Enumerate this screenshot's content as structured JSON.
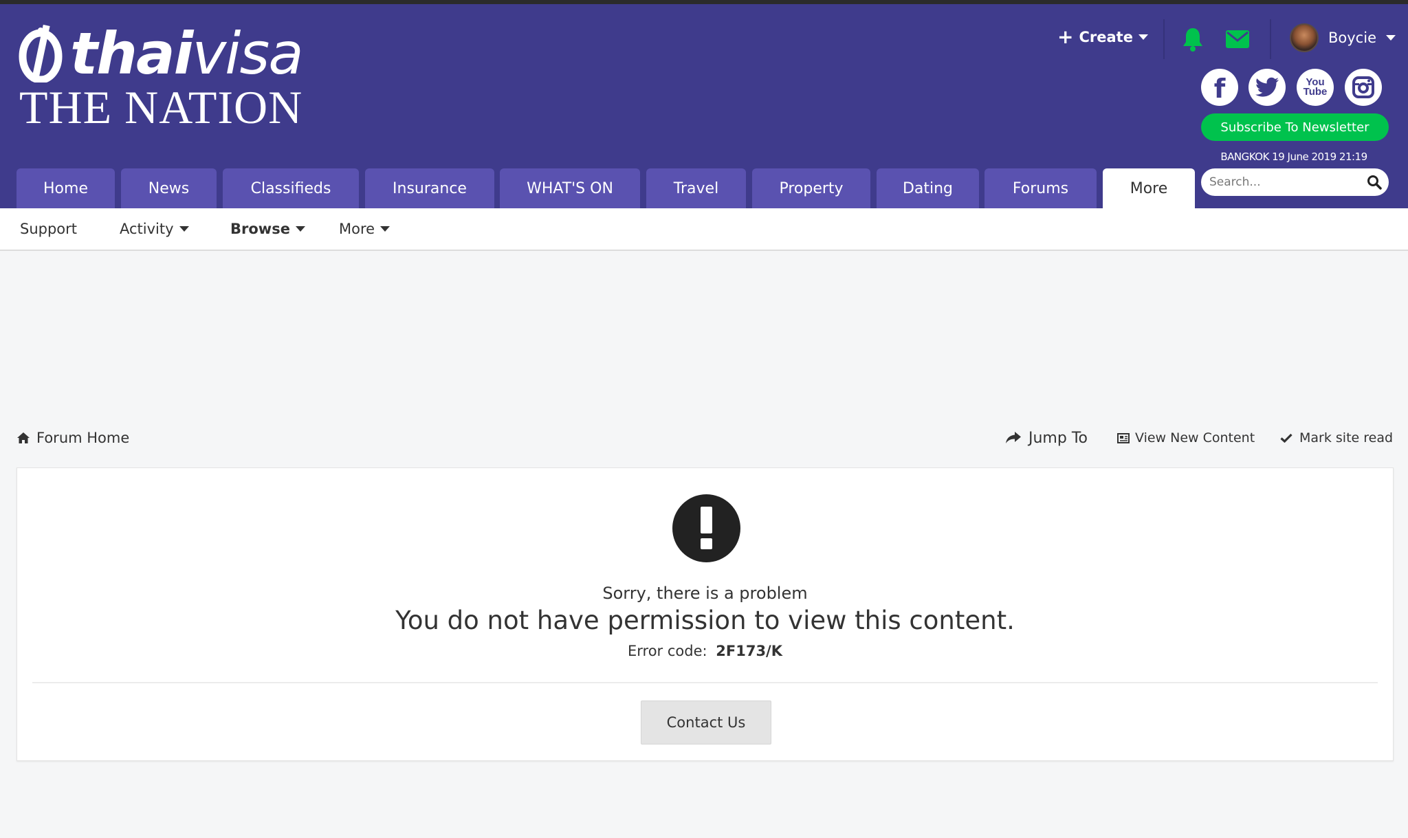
{
  "brand": {
    "logo_thai": "thai",
    "logo_visa": "visa",
    "logo_sub": "THE NATION"
  },
  "header": {
    "create_label": "Create",
    "user_name": "Boycie",
    "subscribe_label": "Subscribe To Newsletter",
    "dateline": "BANGKOK 19 June 2019 21:19",
    "social": [
      "facebook-icon",
      "twitter-icon",
      "youtube-icon",
      "instagram-icon"
    ],
    "youtube_text_1": "You",
    "youtube_text_2": "Tube"
  },
  "nav": {
    "tabs": [
      {
        "label": "Home"
      },
      {
        "label": "News"
      },
      {
        "label": "Classifieds"
      },
      {
        "label": "Insurance"
      },
      {
        "label": "WHAT'S ON"
      },
      {
        "label": "Travel"
      },
      {
        "label": "Property"
      },
      {
        "label": "Dating"
      },
      {
        "label": "Forums"
      },
      {
        "label": "More",
        "active": true
      }
    ],
    "search_placeholder": "Search..."
  },
  "subnav": {
    "items": [
      {
        "label": "Support"
      },
      {
        "label": "Activity"
      },
      {
        "label": "Browse"
      },
      {
        "label": "More"
      }
    ]
  },
  "breadcrumb": {
    "home_label": "Forum Home"
  },
  "actions": {
    "jump_to": "Jump To",
    "view_new": "View New Content",
    "mark_read": "Mark site read"
  },
  "error": {
    "title": "Sorry, there is a problem",
    "message": "You do not have permission to view this content.",
    "code_label": "Error code:",
    "code": "2F173/K",
    "contact_label": "Contact Us"
  },
  "colors": {
    "header_bg": "#3f3b8c",
    "tab_bg": "#5a52b0",
    "accent_green": "#00c24d",
    "page_bg": "#f5f6f7"
  }
}
